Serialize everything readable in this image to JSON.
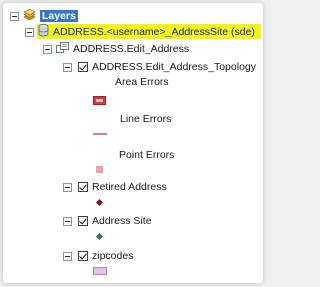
{
  "colors": {
    "highlight": "#f3f31a",
    "selection": "#3478c7",
    "area_error": "#e0363f",
    "line_error": "#e87c80",
    "point_error": "#f0a0a6",
    "retired_marker": "#7a1f1f",
    "site_marker": "#3c6b77",
    "zipcode_fill": "#dcc4ec"
  },
  "tree": {
    "root_label": "Layers",
    "root_icon": "layers-icon",
    "connection": {
      "label": "ADDRESS.<username>_AddressSite (sde)",
      "icon": "database-connection-icon"
    },
    "dataset": {
      "label": "ADDRESS.Edit_Address",
      "icon": "feature-dataset-icon"
    },
    "topology": {
      "label": "ADDRESS.Edit_Address_Topology",
      "legend": {
        "area_errors": "Area Errors",
        "line_errors": "Line Errors",
        "point_errors": "Point Errors"
      }
    },
    "layers": [
      {
        "label": "Retired Address"
      },
      {
        "label": "Address Site"
      },
      {
        "label": "zipcodes"
      }
    ]
  }
}
